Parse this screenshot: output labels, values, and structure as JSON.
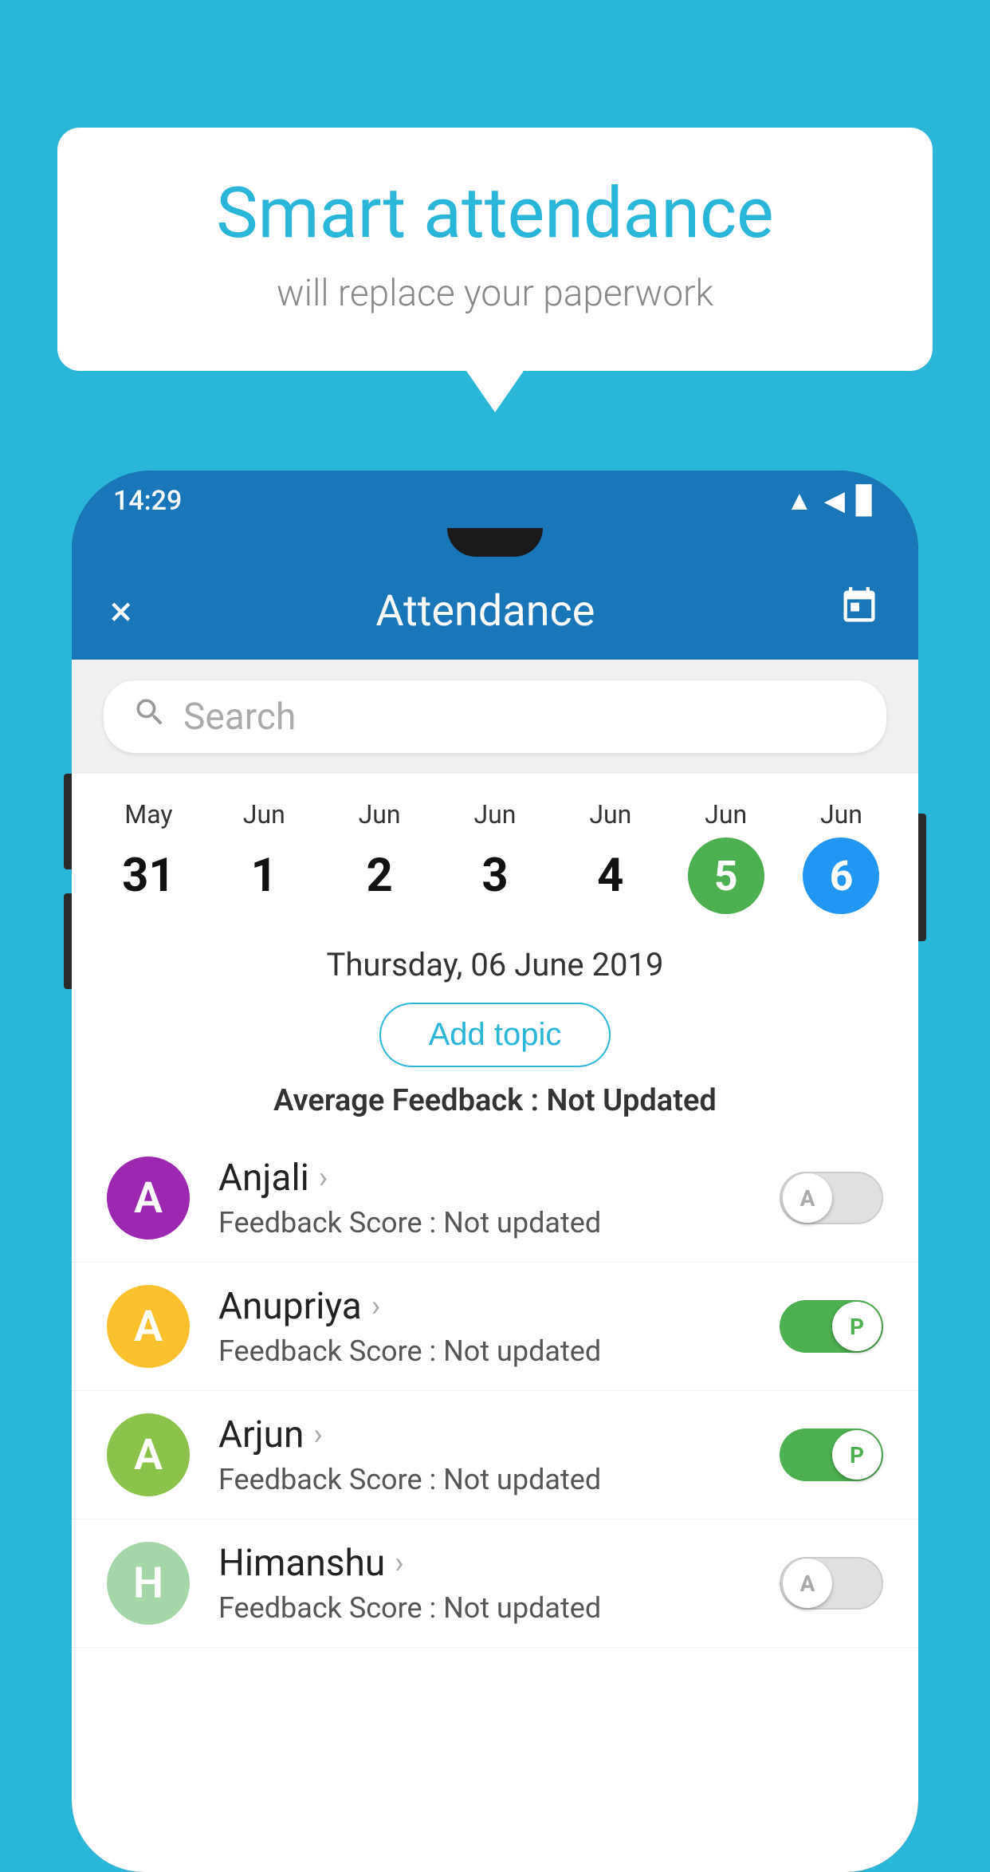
{
  "background_color": "#29b6d8",
  "speech_bubble": {
    "title": "Smart attendance",
    "subtitle": "will replace your paperwork"
  },
  "status_bar": {
    "time": "14:29",
    "icons": [
      "wifi",
      "signal",
      "battery"
    ]
  },
  "app_bar": {
    "title": "Attendance",
    "close_label": "×",
    "calendar_label": "📅"
  },
  "search": {
    "placeholder": "Search"
  },
  "calendar": {
    "days": [
      {
        "month": "May",
        "num": "31",
        "state": "normal"
      },
      {
        "month": "Jun",
        "num": "1",
        "state": "normal"
      },
      {
        "month": "Jun",
        "num": "2",
        "state": "normal"
      },
      {
        "month": "Jun",
        "num": "3",
        "state": "normal"
      },
      {
        "month": "Jun",
        "num": "4",
        "state": "normal"
      },
      {
        "month": "Jun",
        "num": "5",
        "state": "today"
      },
      {
        "month": "Jun",
        "num": "6",
        "state": "selected"
      }
    ]
  },
  "date_full": "Thursday, 06 June 2019",
  "add_topic_label": "Add topic",
  "avg_feedback_label": "Average Feedback :",
  "avg_feedback_value": "Not Updated",
  "students": [
    {
      "name": "Anjali",
      "avatar_letter": "A",
      "avatar_color": "#9c27b0",
      "feedback_label": "Feedback Score :",
      "feedback_value": "Not updated",
      "toggle_state": "off",
      "toggle_letter": "A"
    },
    {
      "name": "Anupriya",
      "avatar_letter": "A",
      "avatar_color": "#fbc02d",
      "feedback_label": "Feedback Score :",
      "feedback_value": "Not updated",
      "toggle_state": "on",
      "toggle_letter": "P"
    },
    {
      "name": "Arjun",
      "avatar_letter": "A",
      "avatar_color": "#8bc34a",
      "feedback_label": "Feedback Score :",
      "feedback_value": "Not updated",
      "toggle_state": "on",
      "toggle_letter": "P"
    },
    {
      "name": "Himanshu",
      "avatar_letter": "H",
      "avatar_color": "#a5d6a7",
      "feedback_label": "Feedback Score :",
      "feedback_value": "Not updated",
      "toggle_state": "off",
      "toggle_letter": "A"
    }
  ]
}
